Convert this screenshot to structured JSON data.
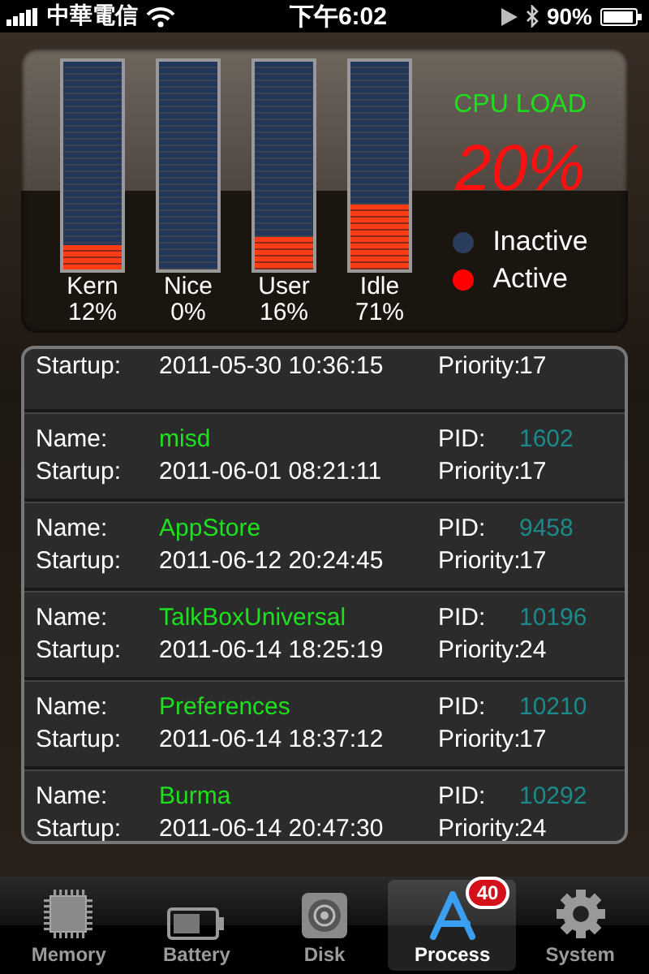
{
  "status_bar": {
    "carrier": "中華電信",
    "time": "下午6:02",
    "battery": "90%"
  },
  "cpu": {
    "bars": [
      {
        "label": "Kern",
        "reading": "12%",
        "level": 0.12
      },
      {
        "label": "Nice",
        "reading": "0%",
        "level": 0
      },
      {
        "label": "User",
        "reading": "16%",
        "level": 0.16
      },
      {
        "label": "Idle",
        "reading": "71%",
        "level": 0.31
      }
    ],
    "title": "CPU LOAD",
    "value": "20%",
    "legend": [
      {
        "label": "Inactive",
        "color": "#2a3d5c"
      },
      {
        "label": "Active",
        "color": "#ff0000"
      }
    ]
  },
  "processes": [
    {
      "startup_label": "Startup:",
      "startup": "2011-05-30 10:36:15",
      "priority_label": "Priority:",
      "priority": "17"
    },
    {
      "name_label": "Name:",
      "name": "misd",
      "pid_label": "PID:",
      "pid": "1602",
      "startup_label": "Startup:",
      "startup": "2011-06-01 08:21:11",
      "priority_label": "Priority:",
      "priority": "17"
    },
    {
      "name_label": "Name:",
      "name": "AppStore",
      "pid_label": "PID:",
      "pid": "9458",
      "startup_label": "Startup:",
      "startup": "2011-06-12 20:24:45",
      "priority_label": "Priority:",
      "priority": "17"
    },
    {
      "name_label": "Name:",
      "name": "TalkBoxUniversal",
      "pid_label": "PID:",
      "pid": "10196",
      "startup_label": "Startup:",
      "startup": "2011-06-14 18:25:19",
      "priority_label": "Priority:",
      "priority": "24"
    },
    {
      "name_label": "Name:",
      "name": "Preferences",
      "pid_label": "PID:",
      "pid": "10210",
      "startup_label": "Startup:",
      "startup": "2011-06-14 18:37:12",
      "priority_label": "Priority:",
      "priority": "17"
    },
    {
      "name_label": "Name:",
      "name": "Burma",
      "pid_label": "PID:",
      "pid": "10292",
      "startup_label": "Startup:",
      "startup": "2011-06-14 20:47:30",
      "priority_label": "Priority:",
      "priority": "24"
    }
  ],
  "tabs": [
    {
      "kind": "chip",
      "label": "Memory",
      "selected": false
    },
    {
      "kind": "battery",
      "label": "Battery",
      "selected": false
    },
    {
      "kind": "disk",
      "label": "Disk",
      "selected": false
    },
    {
      "kind": "appstore",
      "label": "Process",
      "selected": true,
      "badge": "40"
    },
    {
      "kind": "gear",
      "label": "System",
      "selected": false
    }
  ]
}
